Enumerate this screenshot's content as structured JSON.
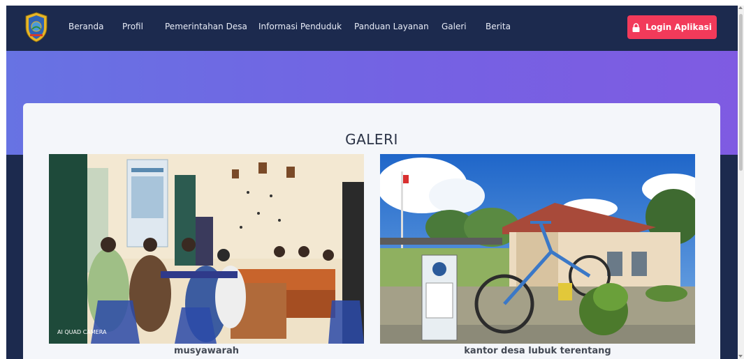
{
  "navbar": {
    "items": [
      {
        "label": "Beranda"
      },
      {
        "label": "Profil"
      },
      {
        "label": "Pemerintahan Desa"
      },
      {
        "label": "Informasi Penduduk"
      },
      {
        "label": "Panduan Layanan"
      },
      {
        "label": "Galeri"
      },
      {
        "label": "Berita"
      }
    ],
    "login_label": "Login Aplikasi",
    "login_icon": "lock-icon"
  },
  "gallery": {
    "title": "GALERI",
    "photos": [
      {
        "caption": "musyawarah",
        "watermark": "AI QUAD CAMERA"
      },
      {
        "caption": "kantor desa lubuk terentang"
      }
    ]
  },
  "colors": {
    "navbar_bg": "#1c2a4e",
    "hero_gradient_start": "#6773e3",
    "hero_gradient_end": "#7f5be2",
    "login_button": "#f23a5a"
  }
}
